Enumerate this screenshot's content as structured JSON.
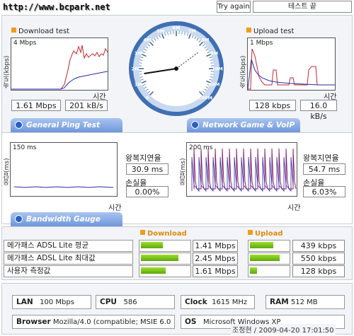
{
  "header": {
    "url": "http://www.bcpark.net",
    "try_again": "Try again",
    "test_end": "테스트 끝"
  },
  "download": {
    "title": "Download test",
    "y_axis": "속도(kbps)",
    "scale": "4 Mbps",
    "x_axis": "시간",
    "mbps": "1.61 Mbps",
    "kbs": "201 kB/s"
  },
  "upload": {
    "title": "Upload test",
    "y_axis": "속도(kbps)",
    "scale": "1 Mbps",
    "x_axis": "시간",
    "kbps": "128 kbps",
    "kbs": "16.0 kB/s"
  },
  "gauge": {
    "ticks": [
      "0",
      "1M",
      "2M",
      "3M",
      "4M",
      "5M",
      "6M",
      "7M",
      "8M",
      "9M",
      "10M",
      "50M",
      "100M"
    ],
    "value_mbps": 1.61
  },
  "tabs": {
    "ping": "General Ping Test",
    "game": "Network Game & VoIP Test",
    "bandwidth": "Bandwidth Gauge"
  },
  "ping": {
    "y_axis": "응답(ms)",
    "scale": "150 ms",
    "x_axis": "시간",
    "rtt_label": "왕복지연율",
    "rtt": "30.9 ms",
    "loss_label": "손실율",
    "loss": "0.00%"
  },
  "game": {
    "y_axis": "응답(ms)",
    "scale": "200 ms",
    "x_axis": "시간",
    "rtt_label": "왕복지연율",
    "rtt": "54.7 ms",
    "loss_label": "손실율",
    "loss": "6.03%"
  },
  "bandwidth": {
    "download_header": "Download",
    "upload_header": "Upload",
    "rows": [
      {
        "label": "메가패스 ADSL Lite 평균",
        "down": "1.41 Mbps",
        "down_frac": 0.45,
        "up": "439 kbps",
        "up_frac": 0.62
      },
      {
        "label": "메가패스 ADSL Lite 최대값",
        "down": "2.45 Mbps",
        "down_frac": 0.78,
        "up": "550 kbps",
        "up_frac": 0.78
      },
      {
        "label": "사용자 측정값",
        "down": "1.61 Mbps",
        "down_frac": 0.52,
        "up": "128 kbps",
        "up_frac": 0.18
      }
    ]
  },
  "system": {
    "lan_label": "LAN",
    "lan": "100 Mbps",
    "cpu_label": "CPU",
    "cpu": "586",
    "clock_label": "Clock",
    "clock": "1615 MHz",
    "ram_label": "RAM",
    "ram": "512 MB",
    "browser_label": "Browser",
    "browser": "Mozilla/4.0 (compatible; MSIE 6.0",
    "os_label": "OS",
    "os": "Microsoft Windows XP",
    "timestamp": "조정현 / 2009-04-20 17:01:50"
  },
  "colors": {
    "download_line": "#c0282e",
    "avg_line": "#2a2aa8",
    "accent": "#f39a1a",
    "bar": "#7cc21c"
  }
}
